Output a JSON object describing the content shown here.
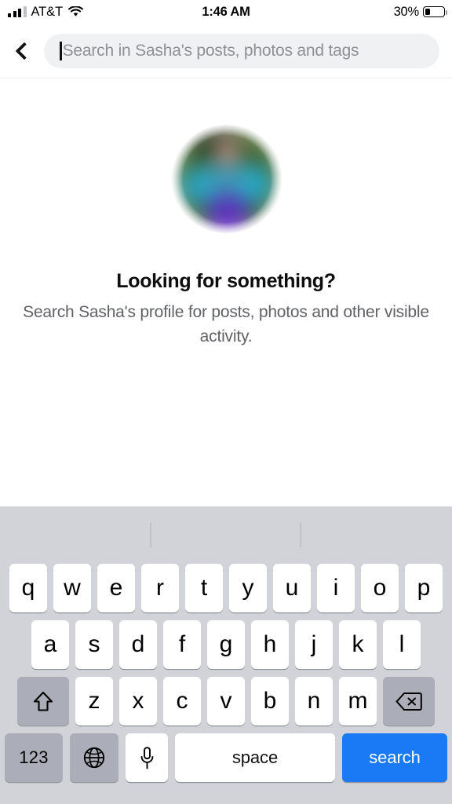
{
  "status_bar": {
    "carrier": "AT&T",
    "signal_icon": "cellular-signal-icon",
    "wifi_icon": "wifi-icon",
    "time": "1:46 AM",
    "battery_percent": "30%",
    "battery_level": 30,
    "battery_icon": "battery-icon"
  },
  "header": {
    "back_icon": "back-chevron-icon",
    "search_placeholder": "Search in Sasha's posts, photos and tags",
    "search_value": "",
    "caret_visible": true
  },
  "content": {
    "avatar_alt": "blurred-profile-photo",
    "headline": "Looking for something?",
    "subtext": "Search Sasha's profile for posts, photos and other visible activity."
  },
  "keyboard": {
    "predictive_suggestions": [
      "",
      "",
      ""
    ],
    "row1": [
      "q",
      "w",
      "e",
      "r",
      "t",
      "y",
      "u",
      "i",
      "o",
      "p"
    ],
    "row2": [
      "a",
      "s",
      "d",
      "f",
      "g",
      "h",
      "j",
      "k",
      "l"
    ],
    "row3": [
      "z",
      "x",
      "c",
      "v",
      "b",
      "n",
      "m"
    ],
    "shift_icon": "shift-arrow-icon",
    "delete_icon": "delete-backspace-icon",
    "numeric_label": "123",
    "globe_icon": "globe-icon",
    "mic_icon": "microphone-icon",
    "space_label": "space",
    "search_label": "search"
  },
  "colors": {
    "accent_blue": "#1a7af5",
    "keyboard_bg": "#d1d3d9",
    "key_white": "#ffffff",
    "key_gray": "#abaeb8",
    "search_field_bg": "#eff1f3",
    "placeholder_text": "#8e9096",
    "subtext_gray": "#606266"
  }
}
